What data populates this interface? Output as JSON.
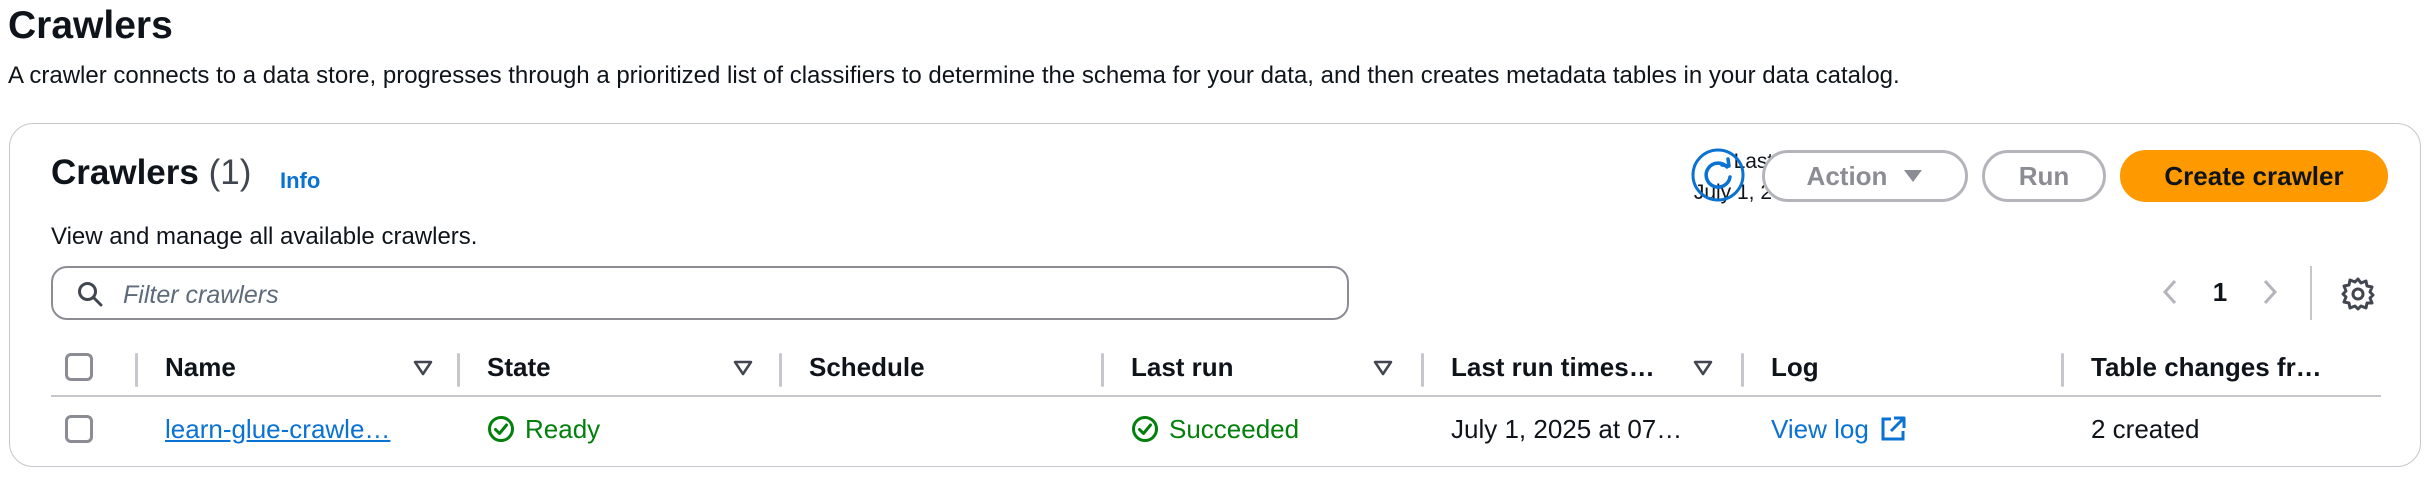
{
  "page": {
    "title": "Crawlers",
    "description": "A crawler connects to a data store, progresses through a prioritized list of classifiers to determine the schema for your data, and then creates metadata tables in your data catalog."
  },
  "panel": {
    "title": "Crawlers",
    "count": "(1)",
    "info_link": "Info",
    "subtitle": "View and manage all available crawlers.",
    "last_updated_label": "Last updated (UTC)",
    "last_updated_value": "July 1, 2025 at 07:58:54",
    "buttons": {
      "action": "Action",
      "run": "Run",
      "create": "Create crawler"
    },
    "search": {
      "placeholder": "Filter crawlers",
      "value": ""
    },
    "pagination": {
      "current_page": "1"
    }
  },
  "table": {
    "columns": [
      "Name",
      "State",
      "Schedule",
      "Last run",
      "Last run times…",
      "Log",
      "Table changes fr…"
    ],
    "rows": [
      {
        "name": "learn-glue-crawle…",
        "state": "Ready",
        "schedule": "",
        "last_run": "Succeeded",
        "last_run_timestamp": "July 1, 2025 at 07…",
        "log": "View log",
        "table_changes": "2 created"
      }
    ]
  },
  "colors": {
    "primary_button": "#ff9900",
    "link": "#0972d3",
    "success": "#037f0c",
    "border": "#c6c6cd"
  },
  "icons": {
    "refresh": "refresh-icon",
    "dropdown": "caret-down-icon",
    "search": "search-icon",
    "prev": "chevron-left-icon",
    "next": "chevron-right-icon",
    "settings": "gear-icon",
    "sort": "sort-caret-icon",
    "status_ok": "check-circle-icon",
    "external": "external-link-icon"
  }
}
